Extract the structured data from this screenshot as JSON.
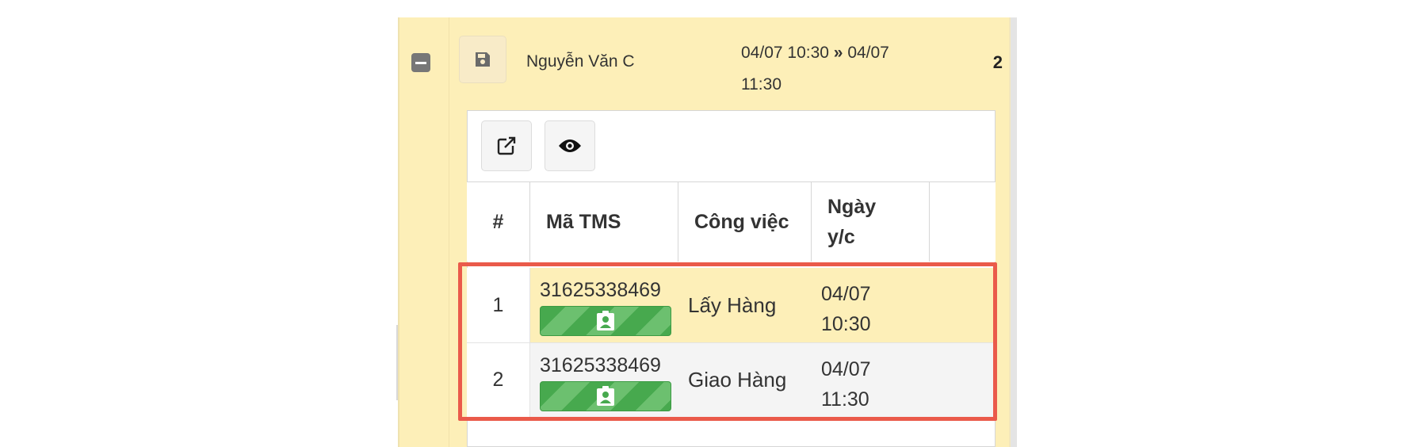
{
  "group": {
    "owner": "Nguyễn Văn C",
    "time_start": "04/07 10:30",
    "time_arrow": "»",
    "time_end_date": "04/07",
    "time_end_time": "11:30",
    "count": "2"
  },
  "toolbar": {
    "open_icon": "external-link-icon",
    "view_icon": "eye-icon"
  },
  "table": {
    "headers": [
      "#",
      "Mã TMS",
      "Công việc",
      "Ngày",
      "y/c"
    ],
    "rows": [
      {
        "index": "1",
        "tms": "31625338469",
        "task": "Lấy Hàng",
        "date": "04/07",
        "time": "10:30"
      },
      {
        "index": "2",
        "tms": "31625338469",
        "task": "Giao Hàng",
        "date": "04/07",
        "time": "11:30"
      }
    ]
  },
  "colors": {
    "group_bg": "#fdefb8",
    "badge_green": "#47a94e",
    "highlight_red": "#ea5a4a"
  }
}
